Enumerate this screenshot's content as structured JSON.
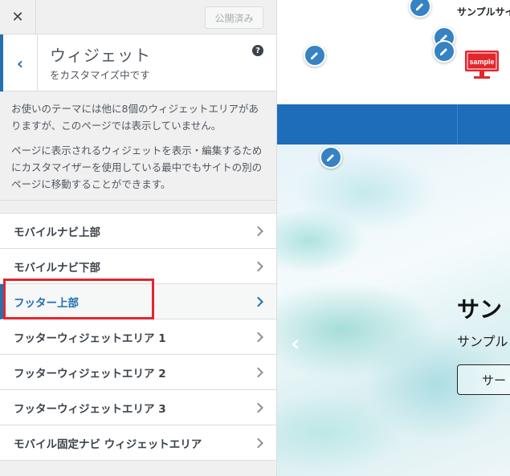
{
  "topbar": {
    "close_icon": "close-icon",
    "close_glyph": "✕",
    "publish_label": "公開済み"
  },
  "section": {
    "back_glyph": "‹",
    "title": "ウィジェット",
    "subtitle": "をカスタマイズ中です",
    "help_glyph": "?"
  },
  "description": {
    "p1": "お使いのテーマには他に8個のウィジェットエリアがありますが、このページでは表示していません。",
    "p2": "ページに表示されるウィジェットを表示・編集するためにカスタマイザーを使用している最中でもサイトの別のページに移動することができます。"
  },
  "widget_areas": [
    {
      "label": "モバイルナビ上部",
      "active": false
    },
    {
      "label": "モバイルナビ下部",
      "active": false
    },
    {
      "label": "フッター上部",
      "active": true
    },
    {
      "label": "フッターウィジェットエリア 1",
      "active": false
    },
    {
      "label": "フッターウィジェットエリア 2",
      "active": false
    },
    {
      "label": "フッターウィジェットエリア 3",
      "active": false
    },
    {
      "label": "モバイル固定ナビ ウィジェットエリア",
      "active": false
    }
  ],
  "preview": {
    "site_name": "サンプルサイ",
    "logo_text": "sample",
    "hero_prev_glyph": "‹",
    "hero_title": "サン",
    "hero_subtitle": "サンプル",
    "hero_button": "サー"
  },
  "colors": {
    "accent": "#2271b1",
    "highlight": "#e3262d",
    "nav": "#1e6dba",
    "logo": "#e3262d"
  }
}
